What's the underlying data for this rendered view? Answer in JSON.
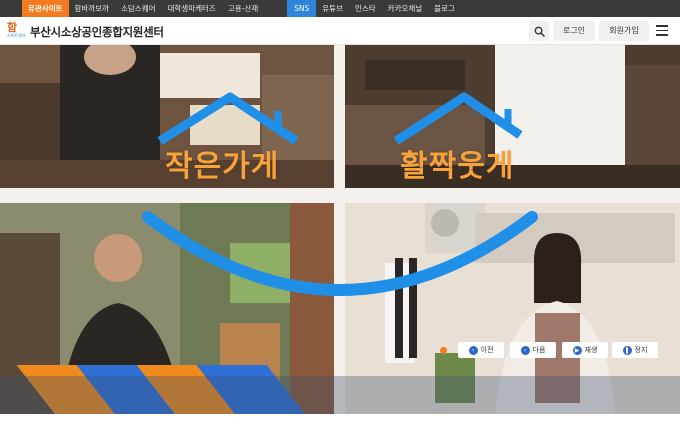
{
  "topbar": {
    "items": [
      "유관사이트",
      "함바까보까",
      "소담스퀘어",
      "대학생마케터즈",
      "고용-산재"
    ],
    "sns_label": "SNS",
    "sns_items": [
      "유튜브",
      "인스타",
      "카카오채널",
      "블로그"
    ]
  },
  "header": {
    "logo_mark": "함",
    "logo_sub": "스마트센터",
    "title": "부산시소상공인종합지원센터",
    "login_label": "로그인",
    "join_label": "회원가입",
    "search_icon": "search-icon",
    "menu_icon": "menu-icon"
  },
  "hero": {
    "caption_left": "작은가게",
    "caption_right": "활짝웃게"
  },
  "controls": {
    "prev_label": "이전",
    "next_label": "다음",
    "play_label": "재생",
    "stop_label": "정지"
  },
  "colors": {
    "topbar_bg": "#3a3a3a",
    "accent_orange": "#f47c20",
    "accent_blue": "#2b86d9",
    "smile_blue": "#1f8fe8",
    "caption_orange": "#f7a23a",
    "control_icon_blue": "#2f66c8"
  }
}
